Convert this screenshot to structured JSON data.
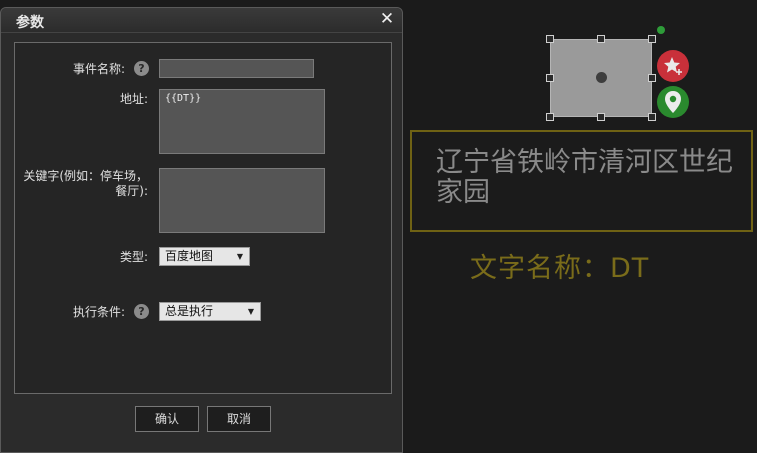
{
  "dialog": {
    "title": "参数",
    "close_icon": "close-icon",
    "fields": {
      "event_name": {
        "label": "事件名称:",
        "value": ""
      },
      "address": {
        "label": "地址:",
        "value": "{{DT}}"
      },
      "keyword": {
        "label_line1": "关键字(例如：停车场，",
        "label_line2": "餐厅):",
        "value": ""
      },
      "type": {
        "label": "类型:",
        "selected": "百度地图"
      },
      "condition": {
        "label": "执行条件:",
        "selected": "总是执行"
      }
    },
    "help_symbol": "?",
    "buttons": {
      "confirm": "确认",
      "cancel": "取消"
    }
  },
  "canvas": {
    "address_text": "辽宁省铁岭市清河区世纪家园",
    "name_label": "文字名称：DT",
    "colors": {
      "fav_icon": "#c9303a",
      "pin_icon": "#2a8a2e",
      "text_border": "#6f6214",
      "name_text": "#7a6c1a"
    }
  }
}
